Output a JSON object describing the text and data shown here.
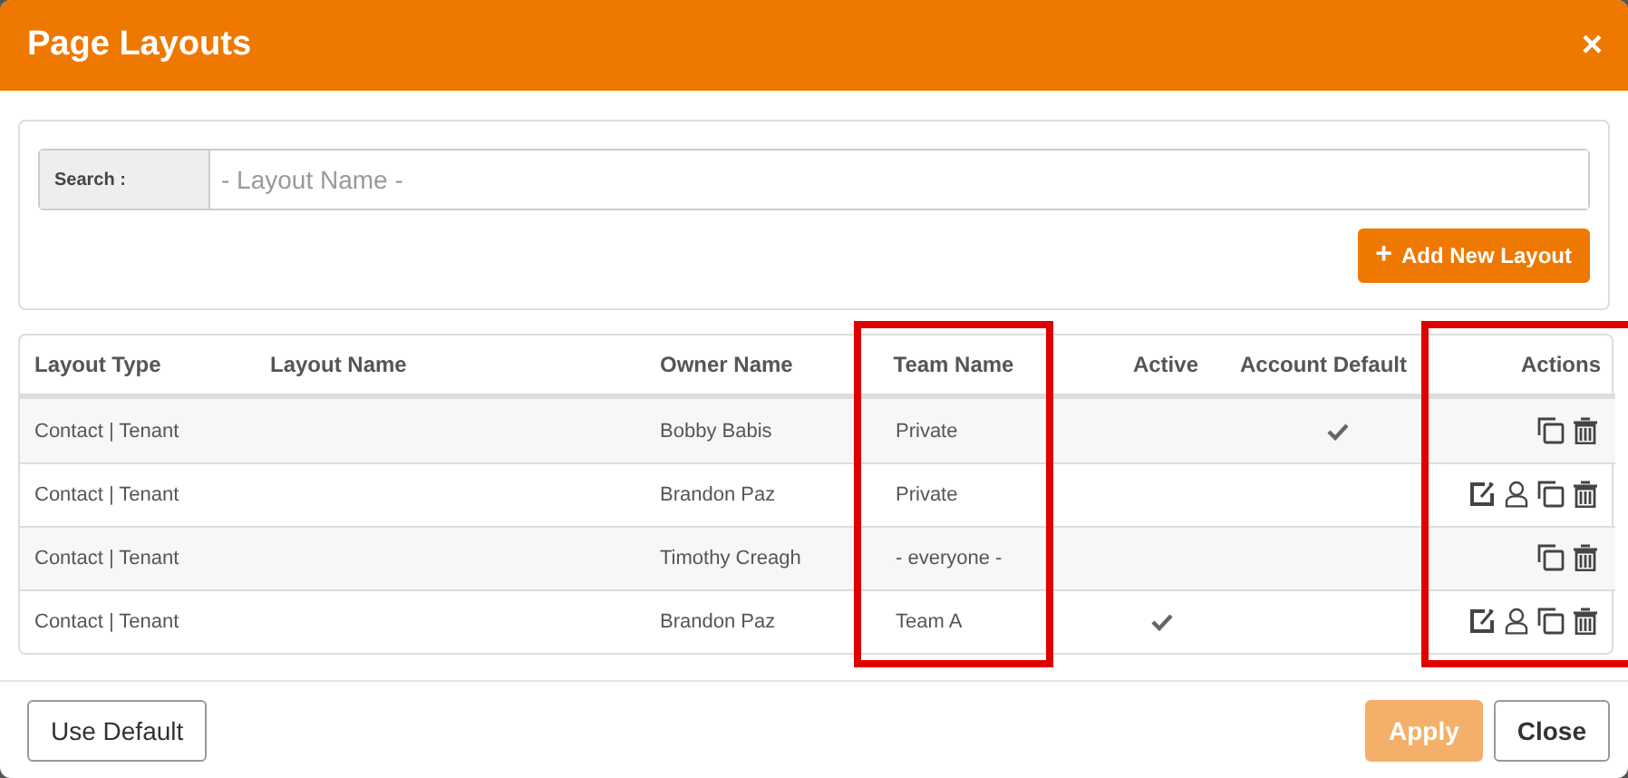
{
  "window": {
    "title": "Page Layouts",
    "close": "×"
  },
  "search": {
    "label": "Search :",
    "placeholder": "- Layout Name -"
  },
  "add_button": {
    "icon": "+",
    "label": "Add New Layout"
  },
  "table": {
    "columns": [
      {
        "label": "Layout Type",
        "highlighted": false
      },
      {
        "label": "Layout Name",
        "highlighted": false
      },
      {
        "label": "Owner Name",
        "highlighted": false
      },
      {
        "label": "Team Name",
        "highlighted": true
      },
      {
        "label": "Active",
        "highlighted": false
      },
      {
        "label": "Account Default",
        "highlighted": false
      },
      {
        "label": "Actions",
        "highlighted": true
      }
    ],
    "rows": [
      {
        "layout_type": "Contact | Tenant",
        "owner_name": "Bobby Babis",
        "team_name": "Private",
        "active": false,
        "account_default": true,
        "actions": [
          {
            "kind": "copy"
          },
          {
            "kind": "delete"
          }
        ]
      },
      {
        "layout_type": "Contact | Tenant",
        "owner_name": "Brandon Paz",
        "team_name": "Private",
        "active": false,
        "account_default": false,
        "actions": [
          {
            "kind": "edit"
          },
          {
            "kind": "user"
          },
          {
            "kind": "copy"
          },
          {
            "kind": "delete"
          }
        ]
      },
      {
        "layout_type": "Contact | Tenant",
        "owner_name": "Timothy Creagh",
        "team_name": "- everyone -",
        "active": false,
        "account_default": false,
        "actions": [
          {
            "kind": "copy"
          },
          {
            "kind": "delete"
          }
        ]
      },
      {
        "layout_type": "Contact | Tenant",
        "owner_name": "Brandon Paz",
        "team_name": "Team A",
        "active": true,
        "account_default": false,
        "actions": [
          {
            "kind": "edit"
          },
          {
            "kind": "user"
          },
          {
            "kind": "copy"
          },
          {
            "kind": "delete"
          }
        ]
      }
    ]
  },
  "footer": {
    "buttons": [
      {
        "label": "Use Default",
        "kind": "outline",
        "disabled": false
      },
      {
        "label": "Apply",
        "kind": "primary",
        "disabled": true
      },
      {
        "label": "Close",
        "kind": "bold",
        "disabled": false
      }
    ]
  }
}
